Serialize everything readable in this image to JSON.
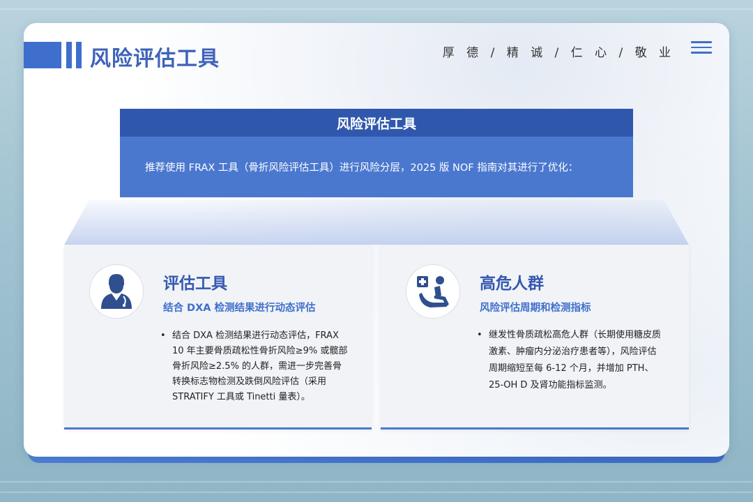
{
  "header": {
    "title": "风险评估工具",
    "motto": "厚 德 / 精 诚 / 仁 心 / 敬 业"
  },
  "info_box": {
    "title": "风险评估工具",
    "text": "推荐使用 FRAX 工具（骨折风险评估工具）进行风险分层，2025 版 NOF 指南对其进行了优化："
  },
  "cards": [
    {
      "icon": "doctor-icon",
      "title": "评估工具",
      "subtitle": "结合 DXA 检测结果进行动态评估",
      "bullet": "•",
      "text": "结合 DXA 检测结果进行动态评估，FRAX 10 年主要骨质疏松性骨折风险≥9% 或髋部骨折风险≥2.5% 的人群，需进一步完善骨转换标志物检测及跌倒风险评估（采用 STRATIFY 工具或 Tinetti 量表）。"
    },
    {
      "icon": "patient-chair-icon",
      "title": "高危人群",
      "subtitle": "风险评估周期和检测指标",
      "bullet": "•",
      "text": "继发性骨质疏松高危人群（长期使用糖皮质激素、肿瘤内分泌治疗患者等），风险评估周期缩短至每 6-12 个月，并增加 PTH、25-OH D 及肾功能指标监测。"
    }
  ],
  "colors": {
    "accent": "#3f6fcc",
    "dark_blue": "#2f58ad",
    "title_blue": "#3559b0"
  }
}
